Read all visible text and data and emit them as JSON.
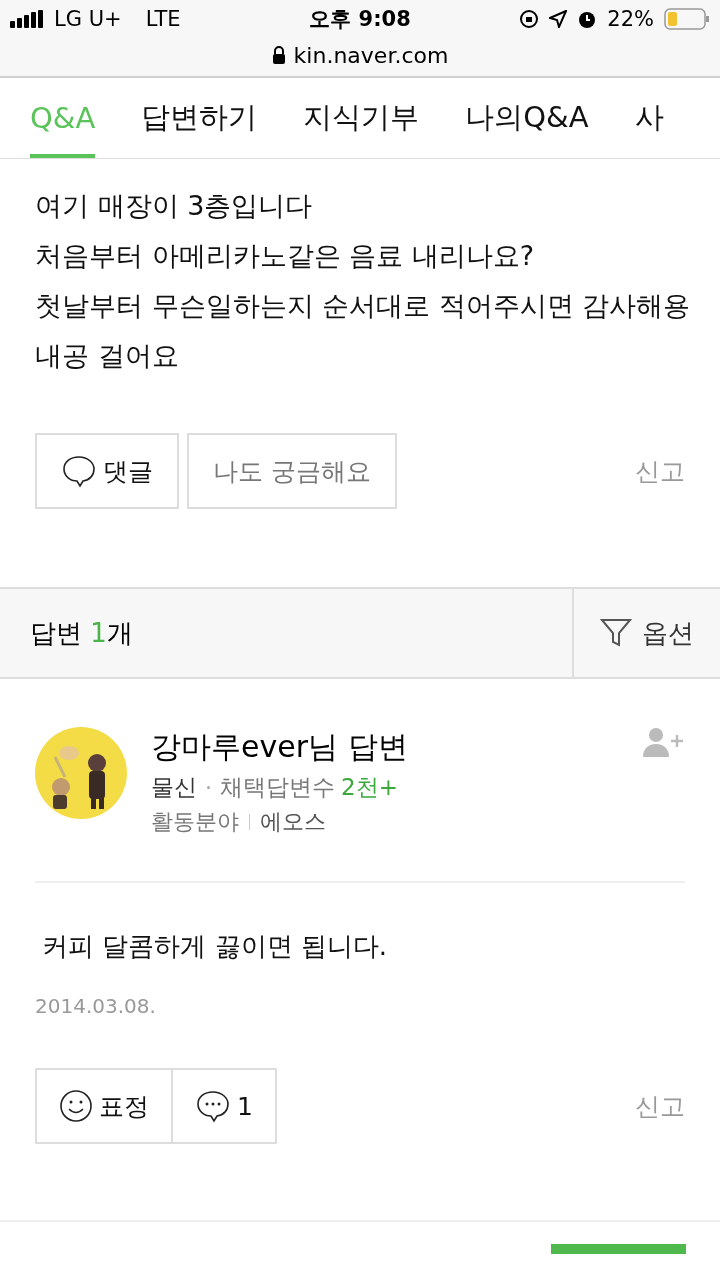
{
  "status_bar": {
    "carrier": "LG U+",
    "network": "LTE",
    "time": "오후 9:08",
    "battery": "22%",
    "url": "kin.naver.com"
  },
  "tabs": [
    {
      "label": "Q&A",
      "selected": true
    },
    {
      "label": "답변하기",
      "selected": false
    },
    {
      "label": "지식기부",
      "selected": false
    },
    {
      "label": "나의Q&A",
      "selected": false
    },
    {
      "label": "사",
      "selected": false
    }
  ],
  "question": {
    "lines": [
      "여기 매장이 3층입니다",
      "처음부터 아메리카노같은 음료 내리나요?",
      "첫날부터 무슨일하는지 순서대로 적어주시면 감사해용",
      "내공 걸어요"
    ],
    "comment_button": "댓글",
    "curious_button": "나도 궁금해요",
    "report": "신고"
  },
  "answers_header": {
    "label": "답변",
    "count": "1",
    "unit": "개",
    "option": "옵션"
  },
  "answer": {
    "author": "강마루ever님 답변",
    "rank": "물신",
    "adopted_label": "채택답변수",
    "adopted_count": "2천+",
    "field_label": "활동분야",
    "field": "에오스",
    "body": "커피 달콤하게 끓이면 됩니다.",
    "date": "2014.03.08.",
    "emotion_button": "표정",
    "comment_count": "1",
    "report": "신고"
  }
}
